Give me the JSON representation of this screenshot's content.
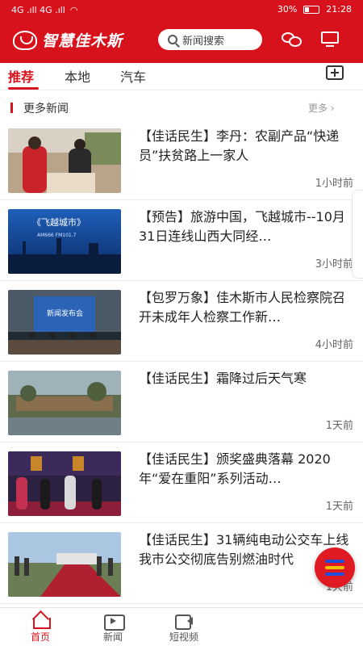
{
  "status_bar": {
    "left": "4G .ıll 4G .ıll",
    "battery": "30%",
    "time": "21:28"
  },
  "header": {
    "logo_text": "智慧佳木斯",
    "search_placeholder": "新闻搜索"
  },
  "tabs": [
    {
      "label": "推荐"
    },
    {
      "label": "本地"
    },
    {
      "label": "汽车"
    }
  ],
  "section": {
    "title": "更多新闻",
    "more": "更多 ›"
  },
  "news": [
    {
      "title": "【佳话民生】李丹：农副产品“快递员”扶贫路上一家人",
      "time": "1小时前"
    },
    {
      "title": "【预告】旅游中国，飞越城市--10月31日连线山西大同经…",
      "time": "3小时前"
    },
    {
      "title": "【包罗万象】佳木斯市人民检察院召开未成年人检察工作新…",
      "time": "4小时前"
    },
    {
      "title": "【佳话民生】霜降过后天气寒",
      "time": "1天前"
    },
    {
      "title": "【佳话民生】颁奖盛典落幕 2020年“爱在重阳”系列活动…",
      "time": "1天前"
    },
    {
      "title": "【佳话民生】31辆纯电动公交车上线 我市公交彻底告别燃油时代",
      "time": "1天前"
    }
  ],
  "thumbnail_text": {
    "t2_title": "《飞越城市》",
    "t2_sub": "AM666  FM101.7",
    "t3_title": "新闻发布会"
  },
  "bottom_nav": [
    {
      "label": "首页"
    },
    {
      "label": "新闻"
    },
    {
      "label": "短视频"
    }
  ],
  "colors": {
    "brand_red": "#d8121c",
    "fab_blue": "#1d4fd8",
    "fab_yellow": "#f2c200"
  }
}
